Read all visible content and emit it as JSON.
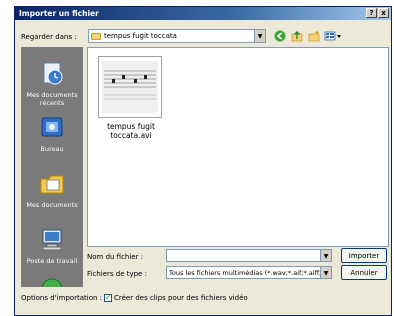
{
  "window": {
    "title": "Importer un fichier",
    "help_btn": "?",
    "close_btn": "x"
  },
  "lookin": {
    "label": "Regarder dans :",
    "value": "tempus fugit toccata"
  },
  "places": [
    {
      "label": "Mes documents récents",
      "icon": "recent-documents-icon"
    },
    {
      "label": "Bureau",
      "icon": "desktop-icon"
    },
    {
      "label": "Mes documents",
      "icon": "my-documents-icon"
    },
    {
      "label": "Poste de travail",
      "icon": "my-computer-icon"
    }
  ],
  "files": [
    {
      "name": "tempus fugit toccata.avi"
    }
  ],
  "filename": {
    "label": "Nom du fichier :",
    "value": ""
  },
  "filetype": {
    "label": "Fichiers de type :",
    "value": "Tous les fichiers multimédias (*.wav;*.aif;*.aiff;*"
  },
  "buttons": {
    "import": "Importer",
    "cancel": "Annuler"
  },
  "options": {
    "label": "Options d'importation :",
    "checkbox_label": "Créer des clips pour des fichiers vidéo",
    "checked": true
  }
}
